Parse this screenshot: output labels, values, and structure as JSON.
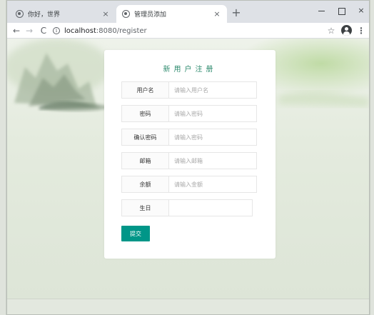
{
  "browser": {
    "tabs": [
      {
        "title": "你好，世界",
        "active": false
      },
      {
        "title": "管理员添加",
        "active": true
      }
    ],
    "new_tab": "+",
    "url": {
      "host": "localhost",
      "path": ":8080/register"
    },
    "nav": {
      "back": "←",
      "forward": "→",
      "reload": "C"
    },
    "star": "☆",
    "menu": "⋮",
    "close_glyph": "×"
  },
  "form": {
    "title": "新用户注册",
    "fields": [
      {
        "label": "用户名",
        "placeholder": "请输入用户名",
        "value": "",
        "type": "text"
      },
      {
        "label": "密码",
        "placeholder": "请输入密码",
        "value": "",
        "type": "password"
      },
      {
        "label": "确认密码",
        "placeholder": "请输入密码",
        "value": "",
        "type": "password"
      },
      {
        "label": "邮箱",
        "placeholder": "请输入邮箱",
        "value": "",
        "type": "text"
      },
      {
        "label": "余额",
        "placeholder": "请输入金额",
        "value": "",
        "type": "text"
      },
      {
        "label": "生日",
        "placeholder": "",
        "value": "",
        "type": "text"
      }
    ],
    "submit_label": "提交"
  },
  "colors": {
    "accent": "#009688",
    "title": "#2e8b6e"
  }
}
